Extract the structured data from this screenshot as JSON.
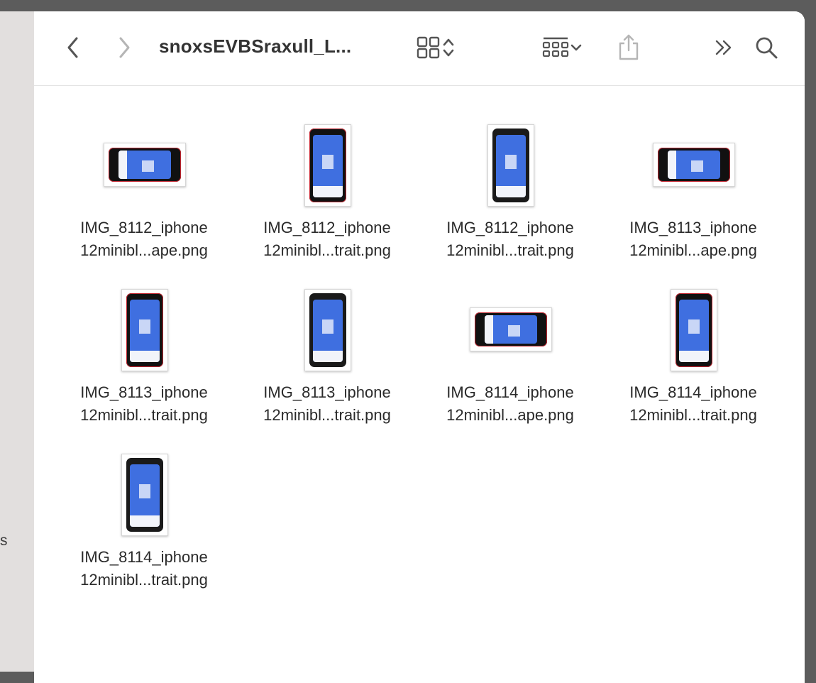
{
  "sidebar": {
    "peek_text": "s"
  },
  "toolbar": {
    "title": "snoxsEVBSraxull_L...",
    "back_icon": "chevron-left-icon",
    "forward_icon": "chevron-right-icon",
    "view_icon": "icon-grid-view-icon",
    "group_icon": "group-by-icon",
    "share_icon": "share-icon",
    "more_icon": "double-chevron-right-icon",
    "search_icon": "magnifying-glass-icon"
  },
  "files": [
    {
      "line1": "IMG_8112_iphone",
      "line2": "12minibl...ape.png",
      "orientation": "landscape",
      "frame": "red"
    },
    {
      "line1": "IMG_8112_iphone",
      "line2": "12minibl...trait.png",
      "orientation": "portrait",
      "frame": "red"
    },
    {
      "line1": "IMG_8112_iphone",
      "line2": "12minibl...trait.png",
      "orientation": "portrait",
      "frame": "black"
    },
    {
      "line1": "IMG_8113_iphone",
      "line2": "12minibl...ape.png",
      "orientation": "landscape",
      "frame": "red"
    },
    {
      "line1": "IMG_8113_iphone",
      "line2": "12minibl...trait.png",
      "orientation": "portrait",
      "frame": "red"
    },
    {
      "line1": "IMG_8113_iphone",
      "line2": "12minibl...trait.png",
      "orientation": "portrait",
      "frame": "black"
    },
    {
      "line1": "IMG_8114_iphone",
      "line2": "12minibl...ape.png",
      "orientation": "landscape",
      "frame": "red"
    },
    {
      "line1": "IMG_8114_iphone",
      "line2": "12minibl...trait.png",
      "orientation": "portrait",
      "frame": "red"
    },
    {
      "line1": "IMG_8114_iphone",
      "line2": "12minibl...trait.png",
      "orientation": "portrait",
      "frame": "black"
    }
  ],
  "colors": {
    "screen_blue": "#3f6fe0",
    "frame_red": "#c0242e",
    "toolbar_icon": "#555555",
    "toolbar_icon_disabled": "#b5b5b5"
  }
}
